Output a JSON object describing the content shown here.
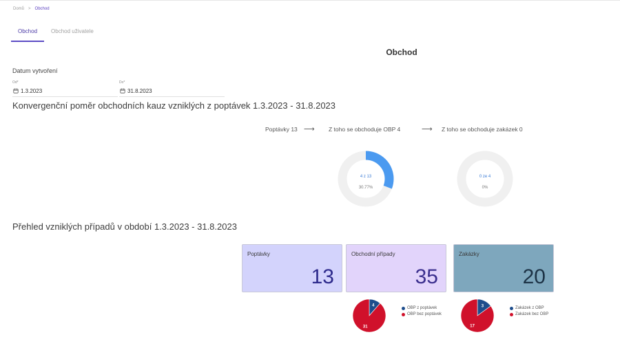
{
  "breadcrumb": {
    "home": "Domů",
    "separator": ">",
    "current": "Obchod"
  },
  "tabs": [
    {
      "label": "Obchod",
      "active": true
    },
    {
      "label": "Obchod uživatele",
      "active": false
    }
  ],
  "page_title": "Obchod",
  "date_filter": {
    "label": "Datum vytvoření",
    "from": {
      "label": "Od*",
      "value": "1.3.2023",
      "icon": "calendar-icon"
    },
    "to": {
      "label": "Do*",
      "value": "31.8.2023",
      "icon": "calendar-icon"
    }
  },
  "conversion": {
    "heading": "Konvergenční poměr obchodních kauz vzniklých z poptávek 1.3.2023 - 31.8.2023",
    "step1": "Poptávky 13",
    "step2": "Z toho se obchoduje OBP 4",
    "step3": "Z toho se obchoduje zakázek 0",
    "arrow": "⟶",
    "donut1": {
      "text": "4 z 13",
      "percent": "30.77%",
      "fraction": 0.3077
    },
    "donut2": {
      "text": "0 ze 4",
      "percent": "0%",
      "fraction": 0
    }
  },
  "overview": {
    "heading": "Přehled vzniklých případů v období 1.3.2023 - 31.8.2023",
    "cards": [
      {
        "title": "Poptávky",
        "value": "13",
        "bg": "#d3d3fc",
        "fg": "#2d2a8c"
      },
      {
        "title": "Obchodní případy",
        "value": "35",
        "bg": "#e2d4fb",
        "fg": "#3b2f8e"
      },
      {
        "title": "Zakázky",
        "value": "20",
        "bg": "#7ea7bd",
        "fg": "#1d3346"
      }
    ]
  },
  "pies": [
    {
      "slices": [
        {
          "label": "OBP z poptávek",
          "value": 4,
          "color": "#1e4d8c"
        },
        {
          "label": "OBP bez poptávek",
          "value": 31,
          "color": "#d0112b"
        }
      ]
    },
    {
      "slices": [
        {
          "label": "Zakázek z OBP",
          "value": 3,
          "color": "#1e4d8c"
        },
        {
          "label": "Zakázek bez OBP",
          "value": 17,
          "color": "#d0112b"
        }
      ]
    }
  ],
  "colors": {
    "accent": "#5b4bc4",
    "donut_fill": "#4b9af0",
    "donut_track": "#f0f0f0",
    "donut_text": "#3a7bd5"
  }
}
